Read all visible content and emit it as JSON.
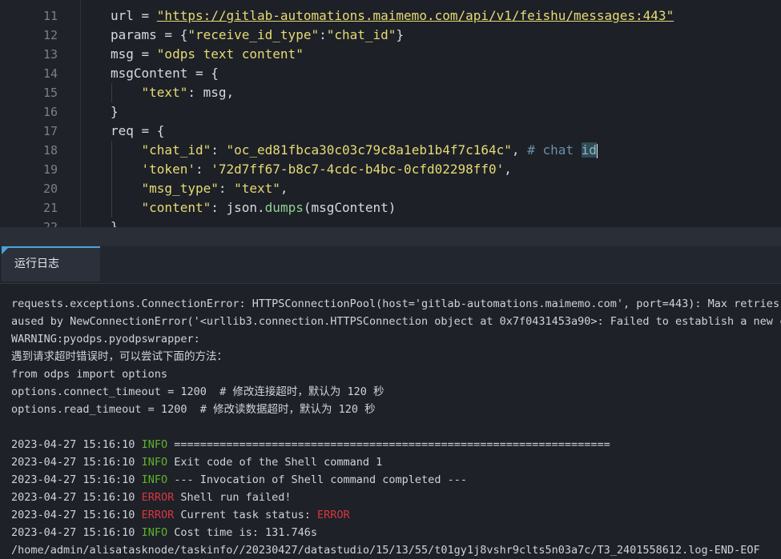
{
  "editor": {
    "line_numbers": [
      "11",
      "12",
      "13",
      "14",
      "15",
      "16",
      "17",
      "18",
      "19",
      "20",
      "21",
      "22"
    ],
    "lines": {
      "l11": {
        "a": "url = ",
        "b": "\"https://gitlab-automations.maimemo.com/api/v1/feishu/messages:443\""
      },
      "l12": {
        "a": "params = {",
        "b": "\"receive_id_type\"",
        "c": ":",
        "d": "\"chat_id\"",
        "e": "}"
      },
      "l13": {
        "a": "msg = ",
        "b": "\"odps text content\""
      },
      "l14": {
        "a": "msgContent = {"
      },
      "l15": {
        "a": "    ",
        "b": "\"text\"",
        "c": ": msg,"
      },
      "l16": {
        "a": "}"
      },
      "l17": {
        "a": "req = {"
      },
      "l18": {
        "a": "    ",
        "b": "\"chat_id\"",
        "c": ": ",
        "d": "\"oc_ed81fbca30c03c79c8a1eb1b4f7c164c\"",
        "e": ", ",
        "f": "# chat ",
        "g": "id"
      },
      "l19": {
        "a": "    ",
        "b": "'token'",
        "c": ": ",
        "d": "'72d7ff67-b8c7-4cdc-b4bc-0cfd02298ff0'",
        "e": ","
      },
      "l20": {
        "a": "    ",
        "b": "\"msg_type\"",
        "c": ": ",
        "d": "\"text\"",
        "e": ","
      },
      "l21": {
        "a": "    ",
        "b": "\"content\"",
        "c": ": json.",
        "d": "dumps",
        "e": "(msgContent)"
      },
      "l22": {
        "a": "}"
      }
    }
  },
  "panel": {
    "tab_label": "运行日志"
  },
  "log": {
    "l1": "requests.exceptions.ConnectionError: HTTPSConnectionPool(host='gitlab-automations.maimemo.com', port=443): Max retries e",
    "l2": "aused by NewConnectionError('<urllib3.connection.HTTPSConnection object at 0x7f0431453a90>: Failed to establish a new co",
    "l3": "WARNING:pyodps.pyodpswrapper:",
    "l4": "遇到请求超时错误时，可以尝试下面的方法：",
    "l5": "from odps import options",
    "l6": "options.connect_timeout = 1200  # 修改连接超时，默认为 120 秒",
    "l7": "options.read_timeout = 1200  # 修改读数据超时，默认为 120 秒",
    "entries": [
      {
        "ts": "2023-04-27 15:16:10 ",
        "level": "INFO",
        "msg": " ==================================================================="
      },
      {
        "ts": "2023-04-27 15:16:10 ",
        "level": "INFO",
        "msg": " Exit code of the Shell command 1"
      },
      {
        "ts": "2023-04-27 15:16:10 ",
        "level": "INFO",
        "msg": " --- Invocation of Shell command completed ---"
      },
      {
        "ts": "2023-04-27 15:16:10 ",
        "level": "ERROR",
        "msg": " Shell run failed!"
      },
      {
        "ts": "2023-04-27 15:16:10 ",
        "level": "ERROR",
        "msg": " Current task status: ",
        "tail": "ERROR"
      },
      {
        "ts": "2023-04-27 15:16:10 ",
        "level": "INFO",
        "msg": " Cost time is: 131.746s"
      }
    ],
    "last": "/home/admin/alisatasknode/taskinfo//20230427/datastudio/15/13/55/t01gy1j8vshr9clts5n03a7c/T3_2401558612.log-END-EOF"
  }
}
